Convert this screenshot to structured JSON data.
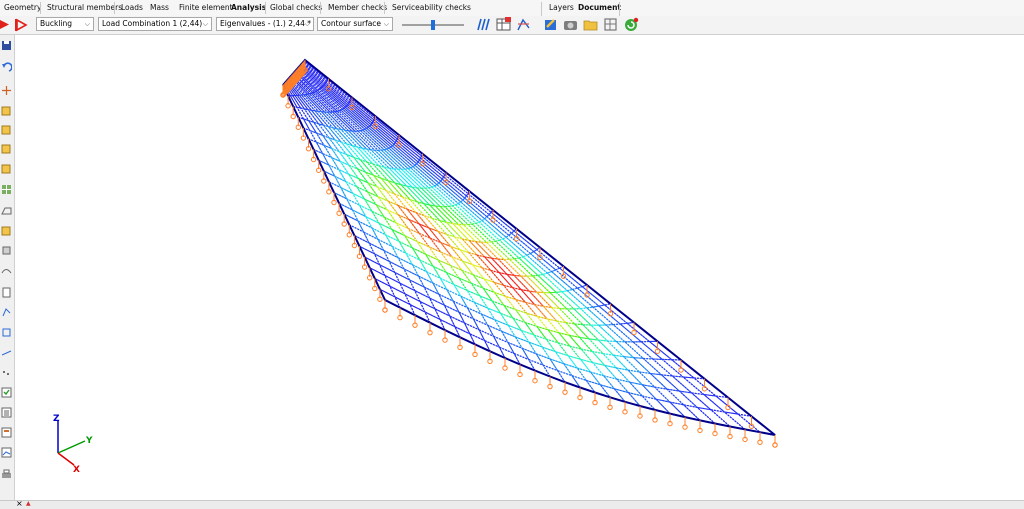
{
  "menu": {
    "tabs": [
      "Geometry",
      "Structural members",
      "Loads",
      "Mass",
      "Finite element",
      "Analysis",
      "Global checks",
      "Member checks",
      "Serviceability checks"
    ],
    "active_tab": "Analysis",
    "right_tabs": [
      "Layers",
      "Document"
    ],
    "right_active": "Document"
  },
  "toolbar": {
    "analysis_type": "Buckling",
    "load_combination": "Load Combination 1 (2,44)",
    "result": "Eigenvalues - (1.) 2,44 *",
    "display": "Contour surface"
  },
  "axes": {
    "z": "Z",
    "y": "Y",
    "x": "X"
  },
  "bottom": {
    "close": "×",
    "mark": "▲"
  },
  "colors": {
    "mesh": "#00008b",
    "support": "#ff7f27",
    "axis_z": "#0000cc",
    "axis_y": "#009900",
    "axis_x": "#dd0000"
  }
}
